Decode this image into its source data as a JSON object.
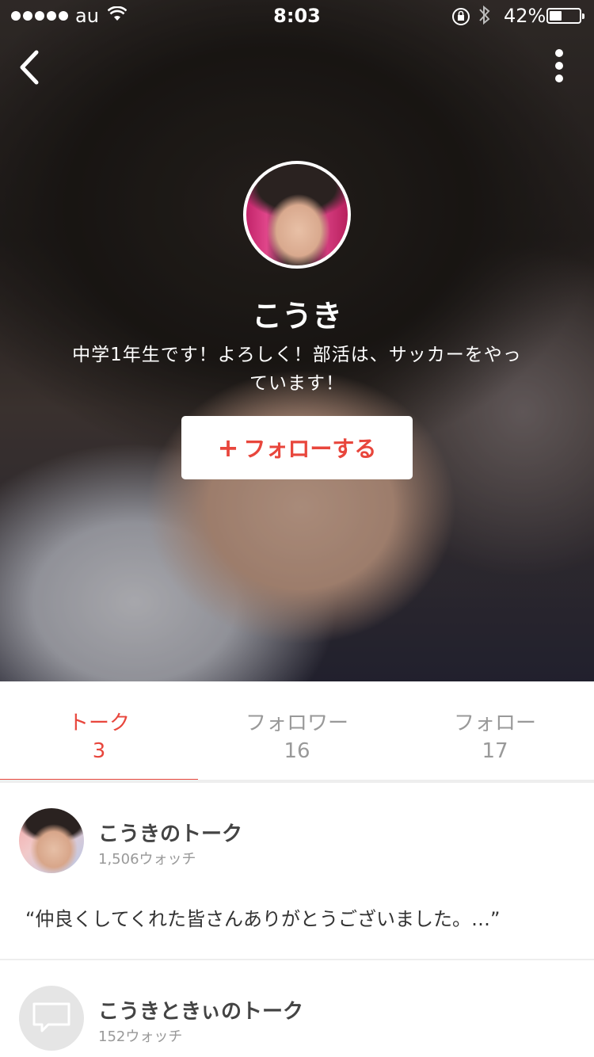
{
  "status_bar": {
    "carrier": "au",
    "time": "8:03",
    "battery_pct": "42%",
    "battery_level": 0.42
  },
  "profile": {
    "name": "こうき",
    "bio": "中学1年生です！よろしく！部活は、サッカーをやっています！",
    "follow_button": "フォローする",
    "follow_plus": "+"
  },
  "tabs": [
    {
      "label": "トーク",
      "count": "3",
      "active": true
    },
    {
      "label": "フォロワー",
      "count": "16",
      "active": false
    },
    {
      "label": "フォロー",
      "count": "17",
      "active": false
    }
  ],
  "talks": [
    {
      "title": "こうきのトーク",
      "watch": "1,506ウォッチ",
      "quote": "“仲良くしてくれた皆さんありがとうございました。…”"
    },
    {
      "title": "こうきときぃのトーク",
      "watch": "152ウォッチ"
    }
  ],
  "colors": {
    "accent": "#e8463c"
  },
  "icons": [
    "back-icon",
    "more-icon",
    "wifi-icon",
    "lock-rotation-icon",
    "bluetooth-icon",
    "speech-bubble-icon"
  ]
}
